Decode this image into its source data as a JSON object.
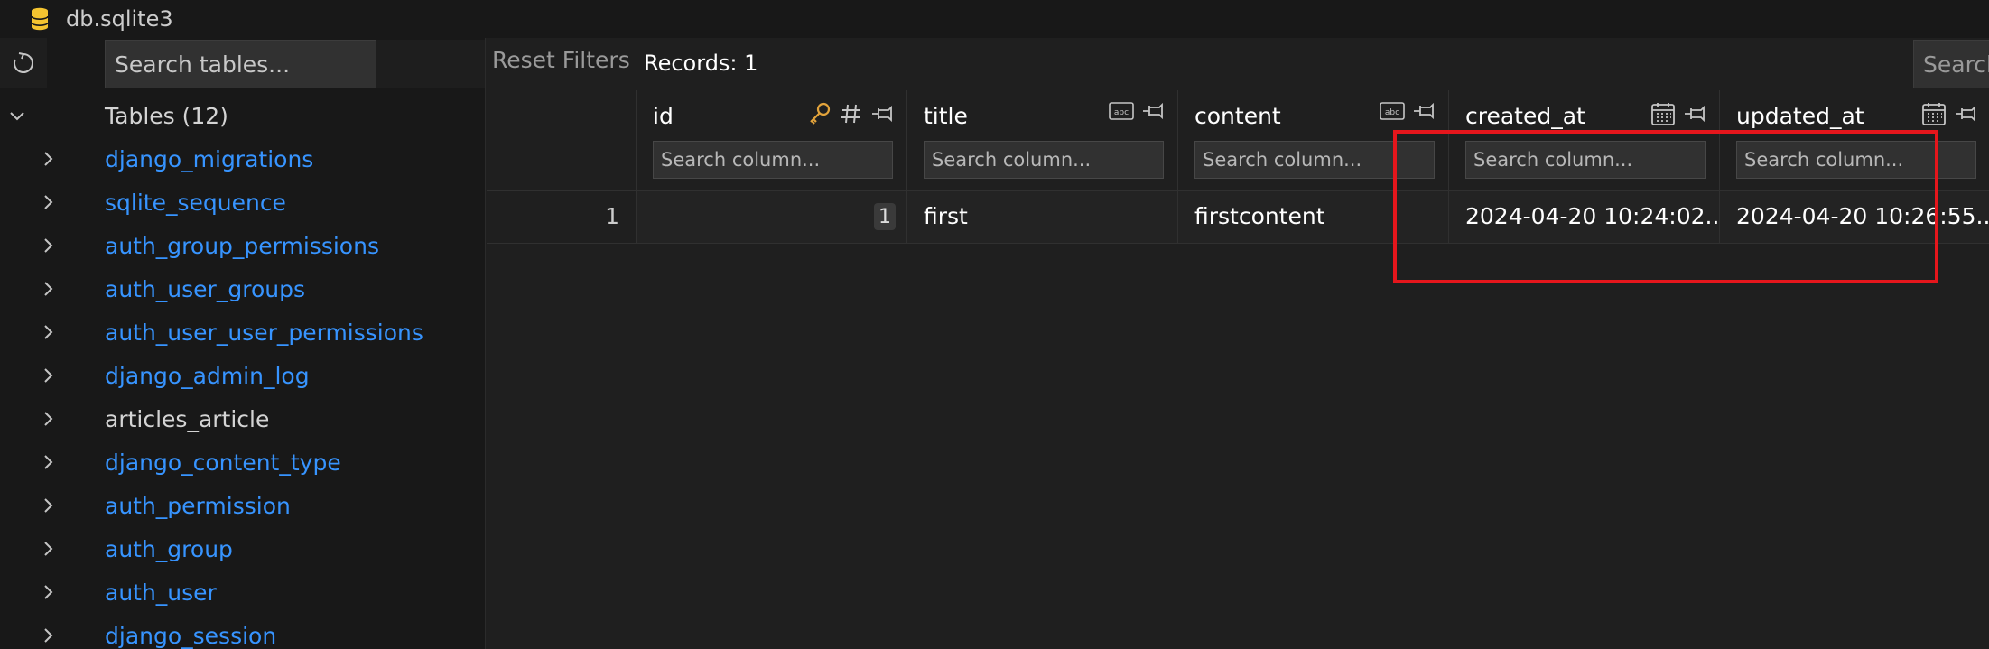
{
  "window": {
    "title": "db.sqlite3"
  },
  "sidebar": {
    "search_placeholder": "Search tables...",
    "root_label": "Tables (12)",
    "tables": [
      {
        "name": "django_migrations"
      },
      {
        "name": "sqlite_sequence"
      },
      {
        "name": "auth_group_permissions"
      },
      {
        "name": "auth_user_groups"
      },
      {
        "name": "auth_user_user_permissions"
      },
      {
        "name": "django_admin_log"
      },
      {
        "name": "articles_article"
      },
      {
        "name": "django_content_type"
      },
      {
        "name": "auth_permission"
      },
      {
        "name": "auth_group"
      },
      {
        "name": "auth_user"
      },
      {
        "name": "django_session"
      }
    ]
  },
  "toolbar": {
    "reset_label": "Reset Filters",
    "records_label": "Records: 1",
    "search_label": "Search"
  },
  "grid": {
    "column_search_placeholder": "Search column...",
    "columns": [
      {
        "name": "id",
        "icons": [
          "key-icon",
          "hash-icon",
          "pin-icon"
        ]
      },
      {
        "name": "title",
        "icons": [
          "text-type-icon",
          "pin-icon"
        ]
      },
      {
        "name": "content",
        "icons": [
          "text-type-icon",
          "pin-icon"
        ]
      },
      {
        "name": "created_at",
        "icons": [
          "calendar-icon",
          "pin-icon"
        ]
      },
      {
        "name": "updated_at",
        "icons": [
          "calendar-icon",
          "pin-icon"
        ]
      }
    ],
    "rows": [
      {
        "row_number": "1",
        "id": "1",
        "title": "first",
        "content": "firstcontent",
        "created_at": "2024-04-20 10:24:02....",
        "updated_at": "2024-04-20 10:26:55...."
      }
    ]
  },
  "colors": {
    "accent_link": "#3794ff",
    "highlight": "#e5161c",
    "key_icon": "#e2a33b",
    "db_icon": "#f4c430"
  }
}
